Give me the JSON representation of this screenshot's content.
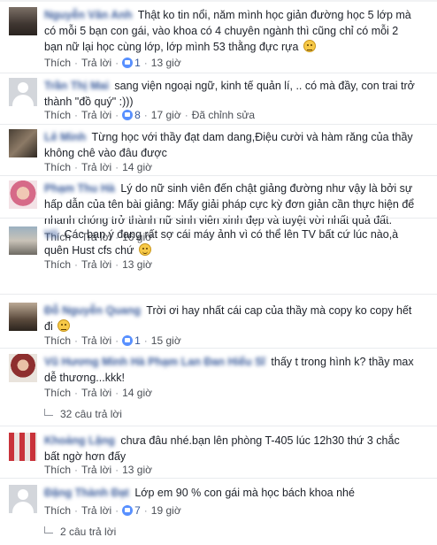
{
  "labels": {
    "like": "Thích",
    "reply": "Trả lời",
    "edited": "Đã chỉnh sửa",
    "dot": "·"
  },
  "comments": [
    {
      "name": "Nguyễn Văn Anh",
      "text": "Thật ko tin nổi, năm mình học giản đường học 5 lớp mà có mỗi 5 bạn con gái, vào khoa có 4 chuyên ngành thì cũng chỉ có mỗi 2 bạn nữ lại học cùng lớp, lớp mình 53 thằng đực rựa",
      "likes": "1",
      "time": "13 giờ",
      "emoji": "neutral"
    },
    {
      "name": "Trần Thị Mai",
      "text": "sang viện ngoại ngữ, kinh tế quản lí, .. có mà đầy, con trai trở thành \"đồ quý\" :)))",
      "likes": "8",
      "time": "17 giờ",
      "edited": true
    },
    {
      "name": "Lê Minh",
      "text": "Từng học với thầy đạt dam dang,Điệu cười và hàm răng của thầy không chê vào đâu được",
      "time": "14 giờ"
    },
    {
      "name": "Phạm Thu Hà",
      "text": "Lý do nữ sinh viên đến chật giảng đường như vậy là bởi sự hấp dẫn của tên bài giảng: Mấy giải pháp cực kỳ đơn giản cần thực hiện để nhanh chóng trở thành nữ sinh viên xinh đẹp và tuyệt vời nhất quả đất.",
      "time": "16 giờ"
    },
    {
      "name": "Vũ",
      "text": "Các bạn ý đang rất sợ cái máy ảnh vì có thể lên TV bất cứ lúc nào,à quên Hust cfs chứ",
      "time": "13 giờ",
      "emoji": "smile"
    },
    {
      "name": "Đỗ Nguyễn Quang",
      "text": "Trời ơi hay nhất cái cap của thầy mà copy ko copy hết đi",
      "likes": "1",
      "time": "15 giờ",
      "emoji": "neutral"
    },
    {
      "name": "Vũ Hương Minh Hà Phạm Lan Đan Hiểu Sĩ",
      "text": "thấy t trong hình k? thầy max dễ thương...kkk!",
      "time": "14 giờ",
      "replies": "32 câu trả lời"
    },
    {
      "name": "Khoảng Lặng",
      "text": "chưa đâu nhé.bạn lên phòng T-405 lúc 12h30 thứ 3 chắc bất ngờ hơn đấy",
      "time": "13 giờ"
    },
    {
      "name": "Đặng Thành Đạt",
      "text": "Lớp em 90 % con gái mà học bách khoa nhé",
      "likes": "7",
      "time": "19 giờ",
      "replies": "2 câu trả lời"
    }
  ]
}
